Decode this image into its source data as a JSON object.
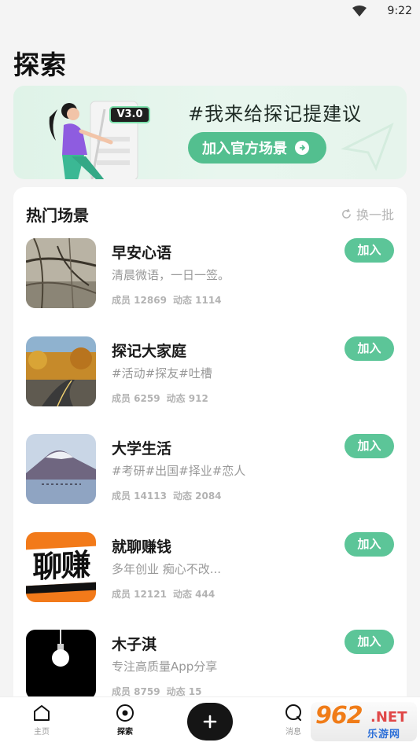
{
  "status_bar": {
    "time": "9:22"
  },
  "page": {
    "title": "探索"
  },
  "banner": {
    "version": "V3.0",
    "headline": "#我来给探记提建议",
    "button_label": "加入官方场景"
  },
  "hot_scenes": {
    "title": "热门场景",
    "refresh_label": "换一批",
    "items": [
      {
        "name": "早安心语",
        "desc": "清晨微语，一日一签。",
        "members": "成员 12869",
        "posts": "动态 1114",
        "join_label": "加入"
      },
      {
        "name": "探记大家庭",
        "desc": "#活动#探友#吐槽",
        "members": "成员 6259",
        "posts": "动态 912",
        "join_label": "加入"
      },
      {
        "name": "大学生活",
        "desc": "#考研#出国#择业#恋人",
        "members": "成员 14113",
        "posts": "动态 2084",
        "join_label": "加入"
      },
      {
        "name": "就聊赚钱",
        "desc": "多年创业 痴心不改...",
        "members": "成员 12121",
        "posts": "动态 444",
        "join_label": "加入"
      },
      {
        "name": "木子淇",
        "desc": "专注高质量App分享",
        "members": "成员 8759",
        "posts": "动态 15",
        "join_label": "加入"
      }
    ]
  },
  "tab_bar": {
    "tabs": [
      {
        "label": "主页"
      },
      {
        "label": "探索"
      },
      {
        "label": "消息"
      }
    ]
  },
  "thumb_text": {
    "money": "聊赚"
  },
  "watermark": {
    "main": "962",
    "net": ".NET",
    "sub": "乐游网"
  },
  "colors": {
    "accent": "#5cc598",
    "banner_bg": "#dff3e8",
    "fab": "#151515"
  }
}
